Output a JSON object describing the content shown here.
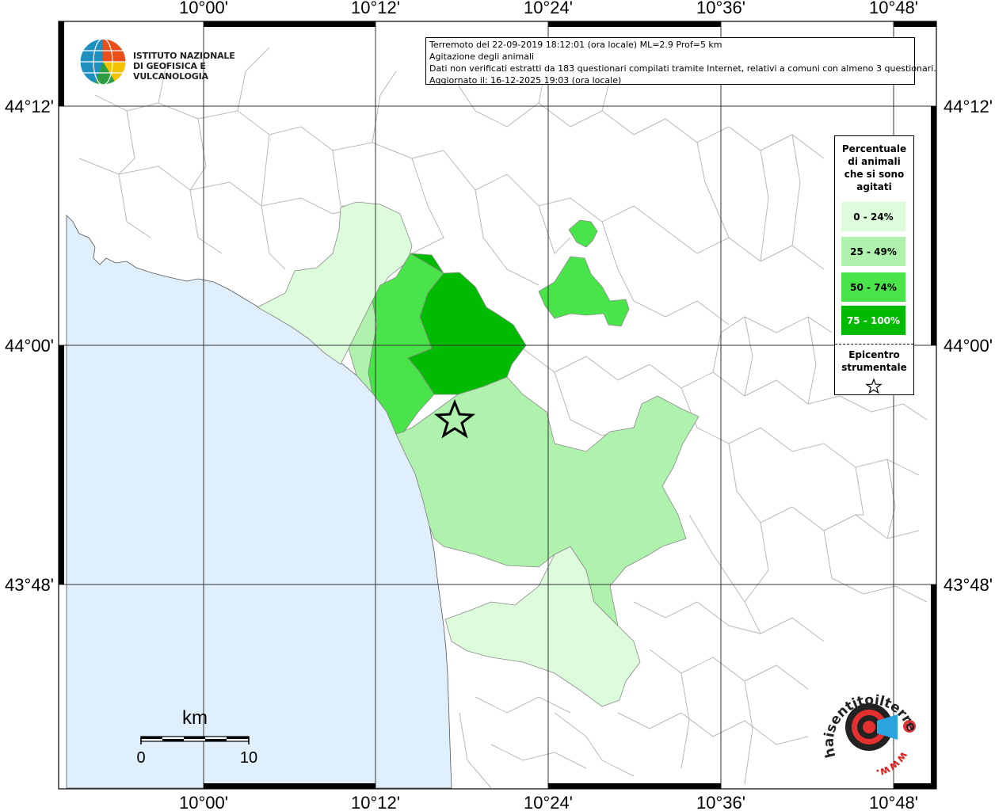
{
  "info": {
    "line1": "Terremoto del 22-09-2019 18:12:01 (ora locale) ML=2.9 Prof=5 km",
    "line2": "Agitazione degli animali",
    "line3": "Dati non verificati estratti da 183 questionari compilati tramite Internet, relativi a comuni con almeno 3 questionari.",
    "line4": "Aggiornato il: 16-12-2025 19:03 (ora locale)"
  },
  "ingv_logo": {
    "line1": "ISTITUTO NAZIONALE",
    "line2": "DI GEOFISICA E VULCANOLOGIA"
  },
  "axes": {
    "lon_labels": [
      "10°00'",
      "10°12'",
      "10°24'",
      "10°36'",
      "10°48'"
    ],
    "lat_labels": [
      "44°12'",
      "44°00'",
      "43°48'"
    ]
  },
  "legend": {
    "title_lines": [
      "Percentuale",
      "di animali",
      "che si sono",
      "agitati"
    ],
    "classes": [
      {
        "label": "0 - 24%",
        "color": "#dcfcdc"
      },
      {
        "label": "25 - 49%",
        "color": "#aef2ae"
      },
      {
        "label": "50 - 74%",
        "color": "#49e449"
      },
      {
        "label": "75 - 100%",
        "color": "#00bb00"
      }
    ],
    "epicenter_lines": [
      "Epicentro",
      "strumentale"
    ]
  },
  "scalebar": {
    "unit": "km",
    "min_label": "0",
    "max_label": "10"
  },
  "hst_logo": {
    "text": "haisentitoilterremoto.it",
    "url_text": "www."
  },
  "colors": {
    "sea": "#dff0fc",
    "grid": "#333333",
    "border": "#bbbbbb"
  }
}
